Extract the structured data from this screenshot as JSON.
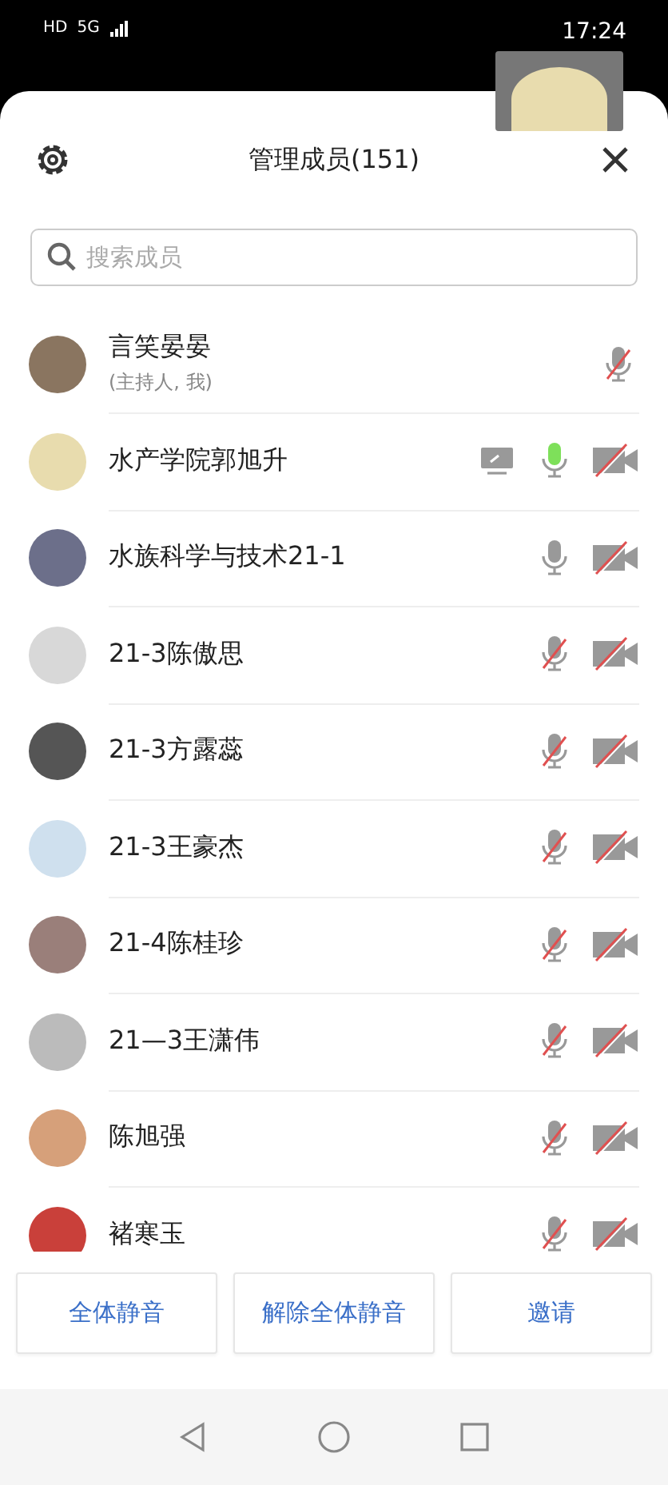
{
  "status_bar": {
    "left": [
      "HD",
      "5G"
    ],
    "time": "17:24"
  },
  "header": {
    "title": "管理成员(151)"
  },
  "search": {
    "placeholder": "搜索成员"
  },
  "members": [
    {
      "name": "言笑晏晏",
      "role": "(主持人, 我)",
      "mic_muted": true,
      "speaking": false,
      "camera_off": false,
      "sharing": false
    },
    {
      "name": "水产学院郭旭升",
      "mic_muted": false,
      "speaking": true,
      "camera_off": true,
      "sharing": true
    },
    {
      "name": "水族科学与技术21-1",
      "mic_muted": false,
      "speaking": false,
      "camera_off": true,
      "sharing": false
    },
    {
      "name": "21-3陈傲思",
      "mic_muted": true,
      "speaking": false,
      "camera_off": true,
      "sharing": false
    },
    {
      "name": "21-3方露蕊",
      "mic_muted": true,
      "speaking": false,
      "camera_off": true,
      "sharing": false
    },
    {
      "name": "21-3王豪杰",
      "mic_muted": true,
      "speaking": false,
      "camera_off": true,
      "sharing": false
    },
    {
      "name": "21-4陈桂珍",
      "mic_muted": true,
      "speaking": false,
      "camera_off": true,
      "sharing": false
    },
    {
      "name": "21—3王潇伟",
      "mic_muted": true,
      "speaking": false,
      "camera_off": true,
      "sharing": false
    },
    {
      "name": "陈旭强",
      "mic_muted": true,
      "speaking": false,
      "camera_off": true,
      "sharing": false
    },
    {
      "name": "褚寒玉",
      "mic_muted": true,
      "speaking": false,
      "camera_off": true,
      "sharing": false
    }
  ],
  "buttons": [
    "全体静音",
    "解除全体静音",
    "邀请"
  ]
}
